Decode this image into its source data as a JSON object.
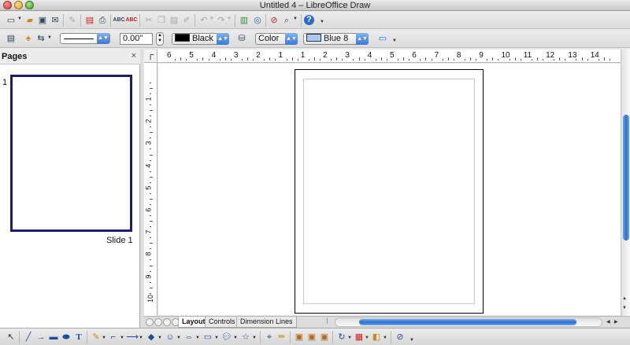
{
  "window": {
    "title": "Untitled 4 – LibreOffice Draw"
  },
  "toolbar_standard": {
    "buttons": [
      "new-document",
      "open",
      "save",
      "email",
      "edit-file",
      "export-pdf",
      "print",
      "spellcheck",
      "autospellcheck",
      "cut",
      "copy",
      "paste",
      "clone-formatting",
      "undo",
      "redo",
      "chart",
      "navigator",
      "zoom",
      "help"
    ]
  },
  "line_toolbar": {
    "line_width": "0.00\"",
    "line_color": {
      "label": "Black",
      "hex": "#000000"
    },
    "area_style": "Color",
    "area_color": {
      "label": "Blue 8",
      "hex": "#a8ccf0"
    }
  },
  "pages_panel": {
    "title": "Pages",
    "close_glyph": "×",
    "slides": [
      {
        "number": "1",
        "label": "Slide 1"
      }
    ]
  },
  "rulers": {
    "horizontal_ticks": [
      "6",
      "5",
      "4",
      "3",
      "2",
      "1",
      "1",
      "2",
      "3",
      "4",
      "5",
      "6",
      "7",
      "8",
      "9",
      "10",
      "11",
      "12",
      "13",
      "14"
    ],
    "vertical_ticks": [
      "1",
      "2",
      "3",
      "4",
      "5",
      "6",
      "7",
      "8",
      "9",
      "10"
    ]
  },
  "layer_tabs": [
    "Layout",
    "Controls",
    "Dimension Lines"
  ],
  "colors": {
    "accent": "#3b78d8",
    "thumbnail_border": "#1f1b6e"
  }
}
